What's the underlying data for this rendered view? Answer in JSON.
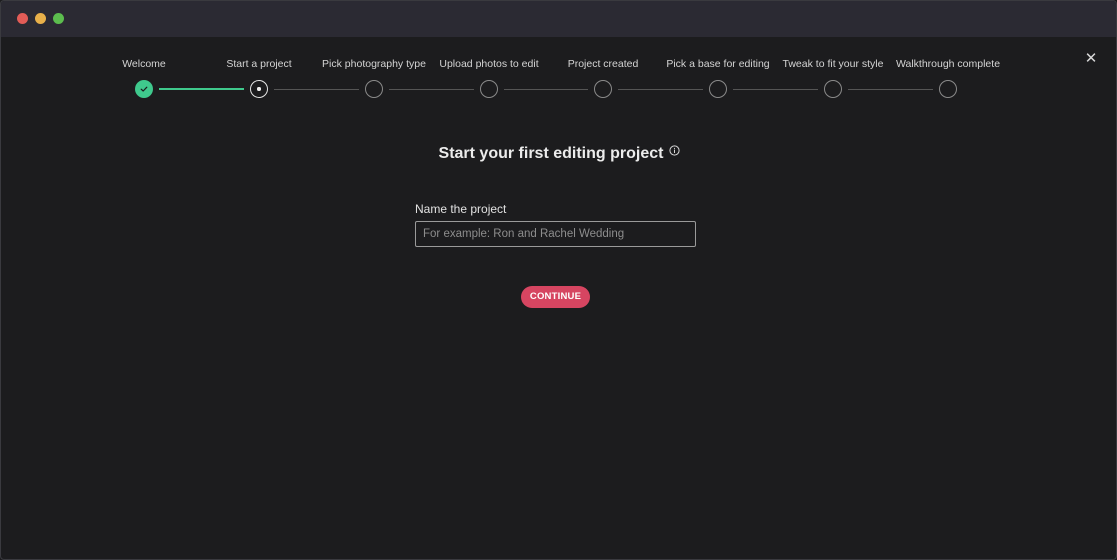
{
  "colors": {
    "accent_green": "#3fc98d",
    "accent_red": "#d64561",
    "traffic_red": "#e25c57",
    "traffic_yellow": "#e8b04a",
    "traffic_green": "#5cbd4e"
  },
  "window": {
    "close_icon": "close-icon",
    "close_glyph": "✕"
  },
  "steps": [
    {
      "label": "Welcome",
      "state": "done"
    },
    {
      "label": "Start a project",
      "state": "current"
    },
    {
      "label": "Pick photography type",
      "state": "todo"
    },
    {
      "label": "Upload photos to edit",
      "state": "todo"
    },
    {
      "label": "Project created",
      "state": "todo"
    },
    {
      "label": "Pick a base for editing",
      "state": "todo"
    },
    {
      "label": "Tweak to fit your style",
      "state": "todo"
    },
    {
      "label": "Walkthrough complete",
      "state": "todo"
    }
  ],
  "main": {
    "title": "Start your first editing project",
    "info_icon": "info-icon",
    "field_label": "Name the project",
    "field_value": "",
    "field_placeholder": "For example: Ron and Rachel Wedding",
    "continue_label": "CONTINUE"
  }
}
